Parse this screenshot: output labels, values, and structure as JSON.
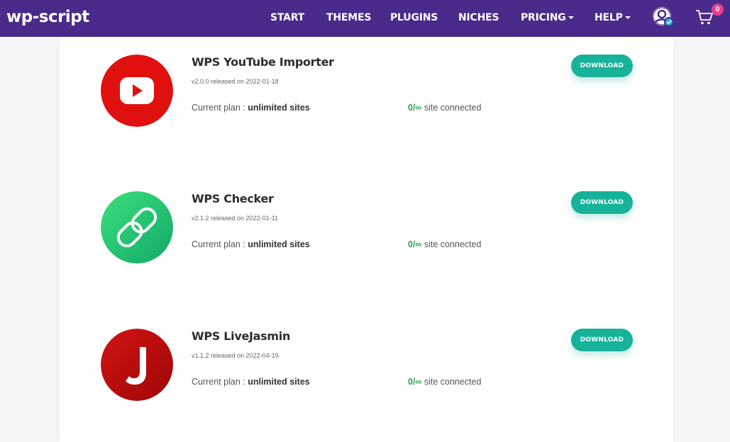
{
  "header": {
    "logo": "wp-script",
    "nav": [
      {
        "label": "START"
      },
      {
        "label": "THEMES"
      },
      {
        "label": "PLUGINS"
      },
      {
        "label": "NICHES"
      },
      {
        "label": "PRICING"
      },
      {
        "label": "HELP"
      }
    ],
    "cart_count": "0"
  },
  "products": [
    {
      "name": "WPS YouTube Importer",
      "release": "v2.0.0 released on 2022-01-18",
      "plan_label": "Current plan : ",
      "plan_value": "unlimited sites",
      "sites_count": "0/∞",
      "sites_label": " site connected",
      "download_label": "DOWNLOAD",
      "icon": "youtube-icon"
    },
    {
      "name": "WPS Checker",
      "release": "v2.1.2 released on 2022-01-11",
      "plan_label": "Current plan : ",
      "plan_value": "unlimited sites",
      "sites_count": "0/∞",
      "sites_label": " site connected",
      "download_label": "DOWNLOAD",
      "icon": "chain-link-icon"
    },
    {
      "name": "WPS LiveJasmin",
      "release": "v1.1.2 released on 2022-04-19",
      "plan_label": "Current plan : ",
      "plan_value": "unlimited sites",
      "sites_count": "0/∞",
      "sites_label": " site connected",
      "download_label": "DOWNLOAD",
      "icon": "livejasmin-j-icon"
    }
  ],
  "colors": {
    "navbar": "#4a2a8a",
    "download_button": "#16b29a",
    "sites_count": "#2aa14b",
    "badge": "#e83e8c"
  }
}
